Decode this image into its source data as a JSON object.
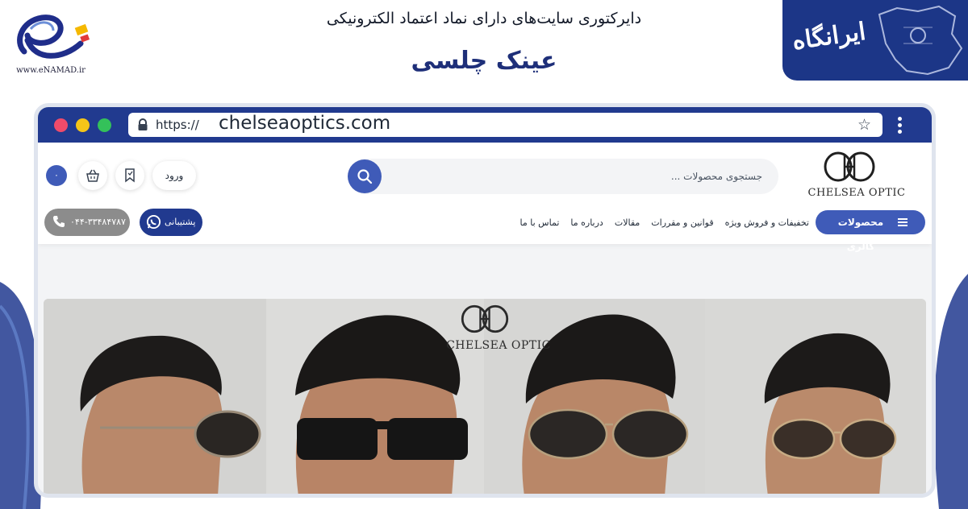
{
  "banner": {
    "directory_title": "دایرکتوری سایت‌های دارای نماد اعتماد الکترونیکی",
    "site_title": "عینک چلسی",
    "enamad_url": "www.eNAMAD.ir",
    "directory_brand": "ایرانگاه"
  },
  "browser": {
    "url_prefix": "https://",
    "url_domain": "chelseaoptics.com",
    "window_dots": [
      "#ef4b6a",
      "#f5c518",
      "#34c15a"
    ]
  },
  "site": {
    "logo_text": "CHELSEA OPTIC",
    "search_placeholder": "جستجوی محصولات ...",
    "login_label": "ورود",
    "cart_count": "۰",
    "gallery_button": "محصولات گالری",
    "nav_links": [
      "تخفیفات و فروش ویژه",
      "قوانین و مقررات",
      "مقالات",
      "درباره ما",
      "تماس با ما"
    ],
    "support_label": "پشتیبانی",
    "phone": "۰۴۴-۳۳۴۸۴۷۸۷"
  },
  "hero": {
    "brand_text": "CHELSEA OPTIC"
  },
  "colors": {
    "primary": "#213a8f",
    "accent": "#3f5bb8",
    "title_blue": "#1e2f79"
  }
}
